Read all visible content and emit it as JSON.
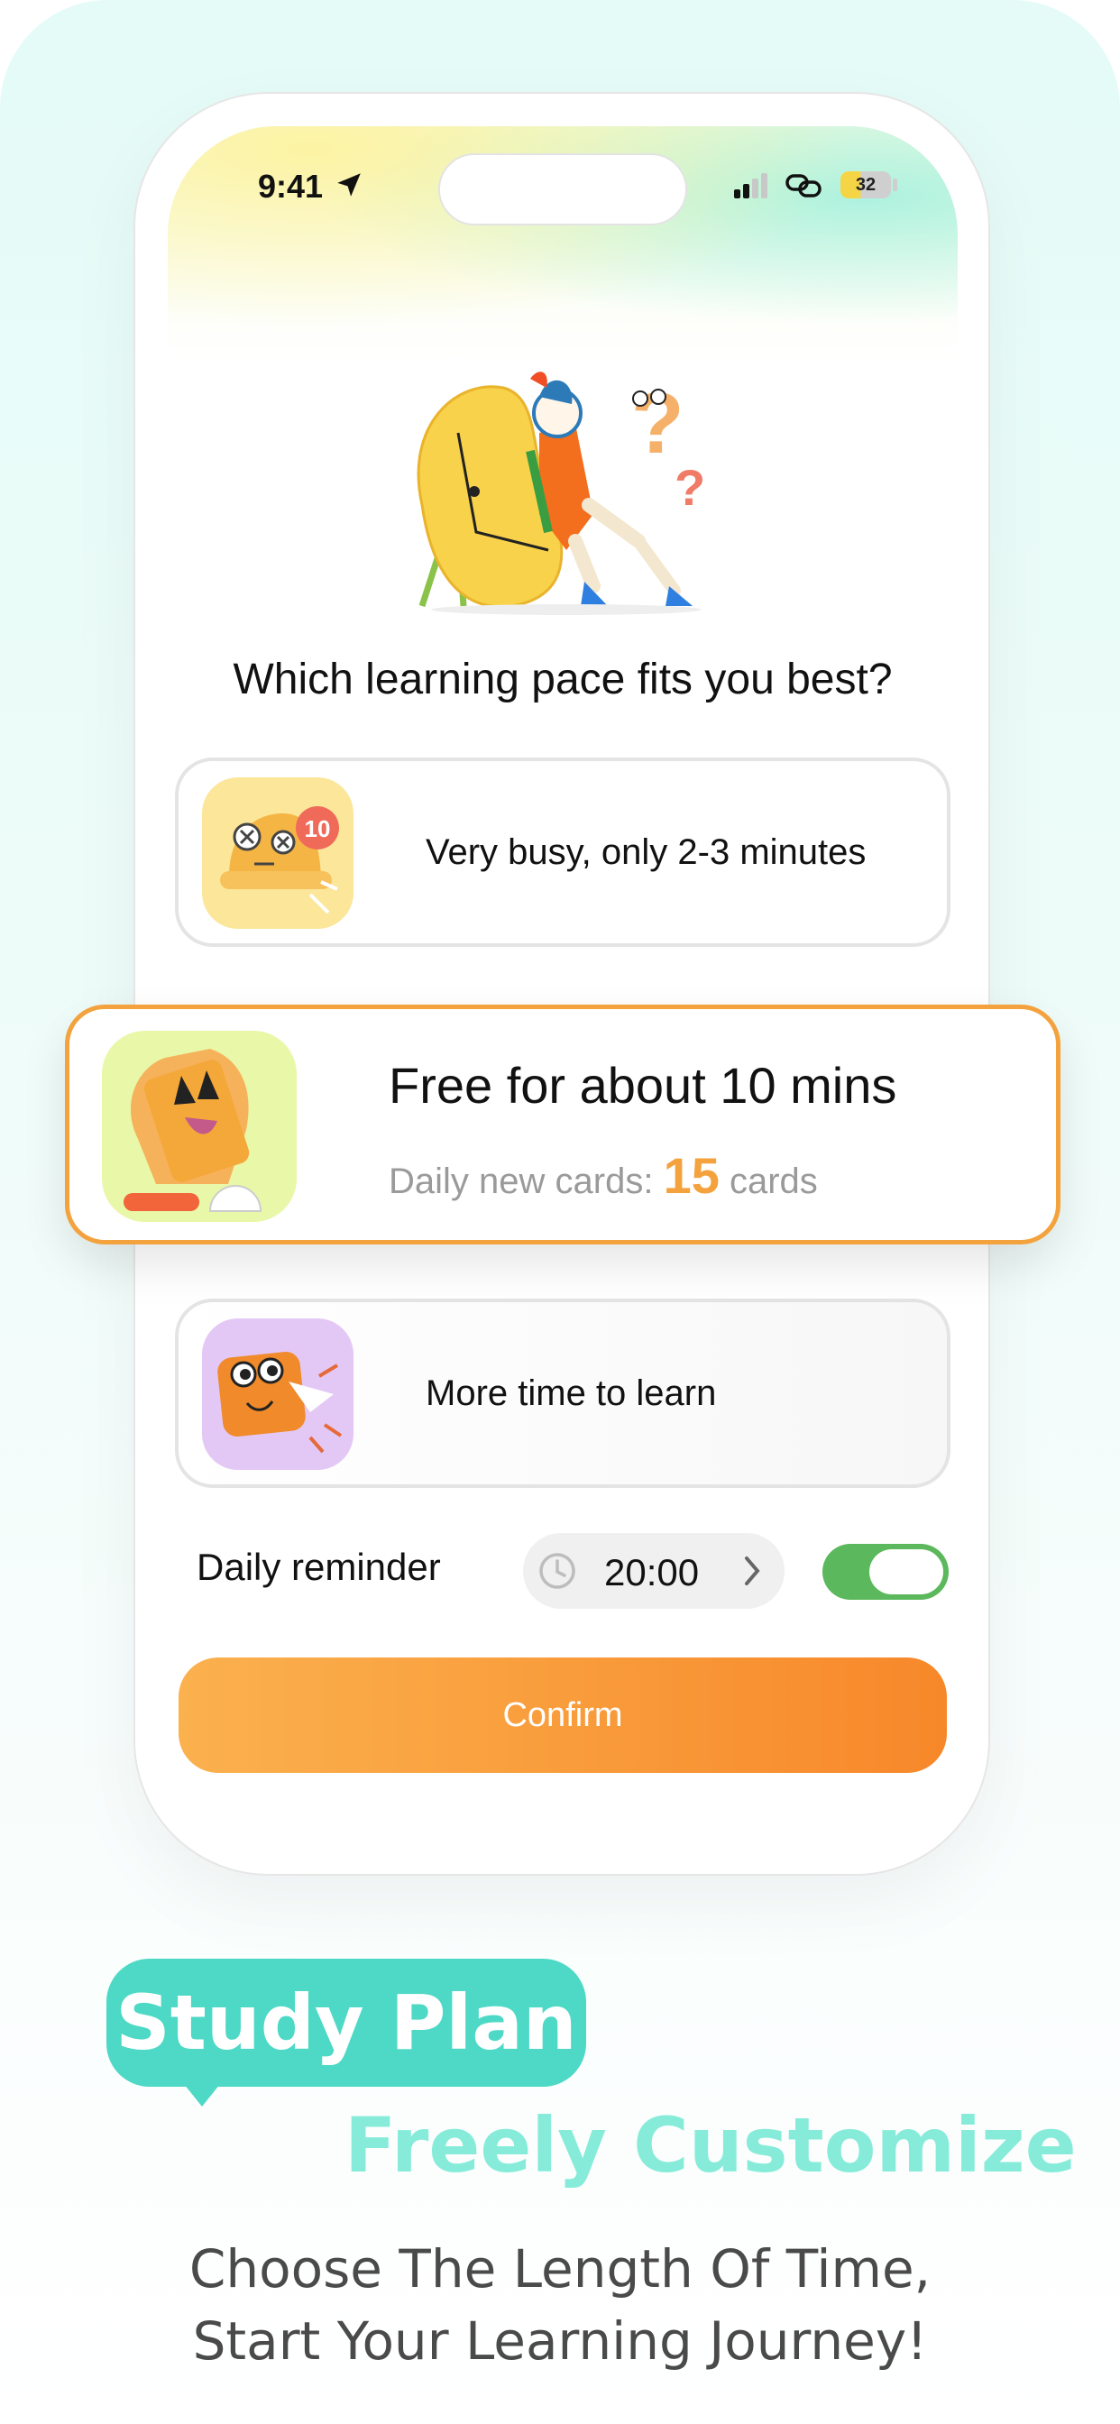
{
  "status_bar": {
    "time": "9:41",
    "battery": "32",
    "icons": [
      "location-arrow-icon",
      "signal-icon",
      "link-icon",
      "battery-icon"
    ]
  },
  "question": "Which learning pace fits you best?",
  "options": [
    {
      "label": "Very busy, only 2-3 minutes",
      "icon": "alarm-bell-illustration",
      "badge": "10",
      "icon_bg": "#fbe69a"
    },
    {
      "title": "Free for about 10 mins",
      "sub_prefix": "Daily new cards:",
      "count": "15",
      "sub_suffix": "cards",
      "icon": "hand-card-illustration",
      "icon_bg": "#e9f7a8",
      "selected": true
    },
    {
      "label": "More time to learn",
      "icon": "flying-card-illustration",
      "icon_bg": "#e3c8f5"
    }
  ],
  "reminder": {
    "label": "Daily reminder",
    "time": "20:00",
    "enabled": true
  },
  "confirm_label": "Confirm",
  "marketing": {
    "bubble": "Study Plan",
    "headline": "Freely Customize",
    "tagline_line1": "Choose The Length Of Time,",
    "tagline_line2": "Start Your Learning Journey!"
  },
  "colors": {
    "accent_orange": "#f3a23d",
    "teal": "#4dd9c6",
    "toggle_green": "#5cb85c"
  }
}
